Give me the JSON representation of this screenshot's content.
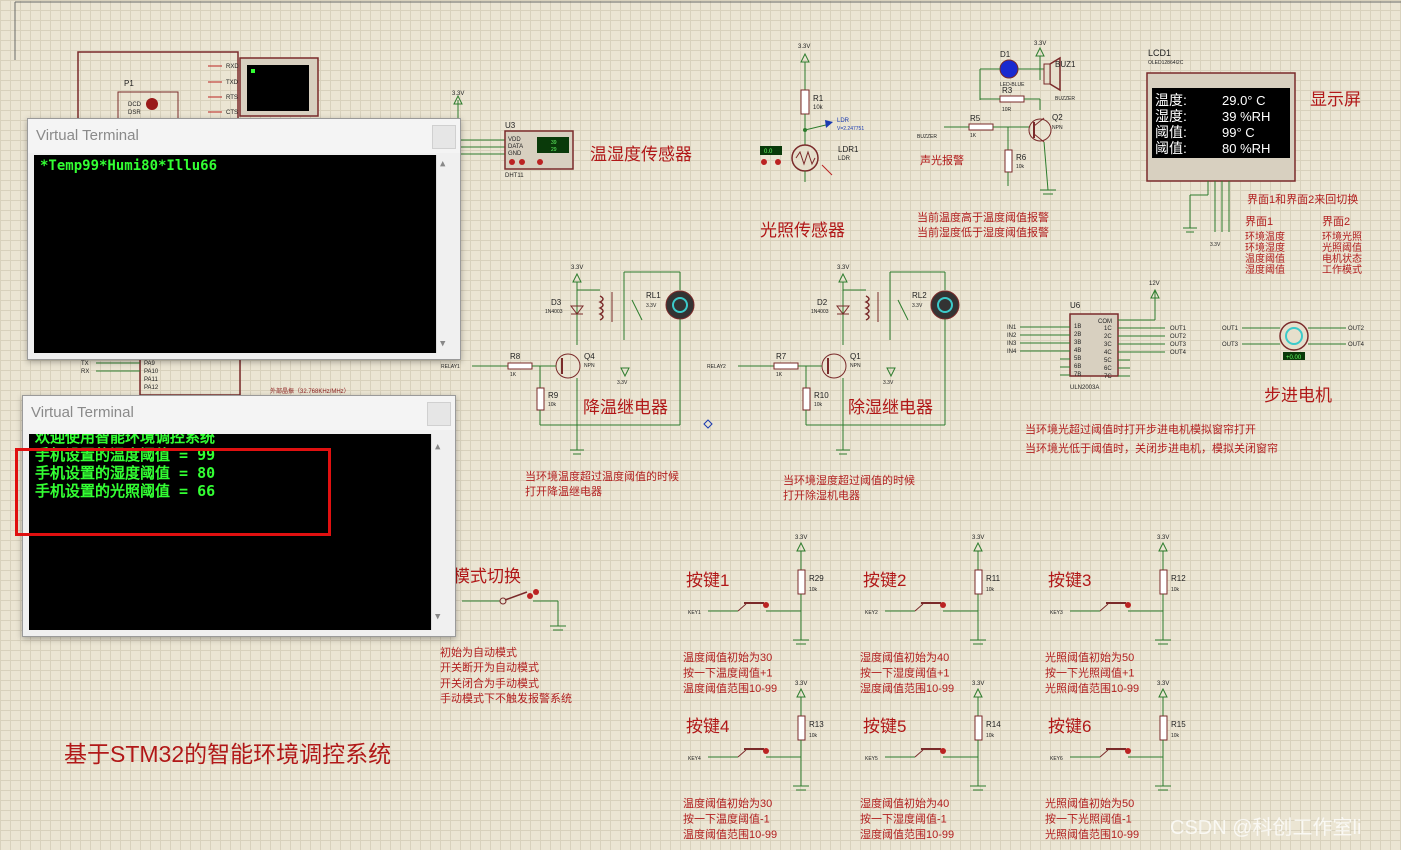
{
  "schematic": {
    "title": "基于STM32的智能环境调控系统",
    "watermark": "CSDN @科创工作室li",
    "labels": {
      "dht_section": "温湿度传感器",
      "ldr_section": "光照传感器",
      "cool_relay": "降温继电器",
      "dehum_relay": "除湿继电器",
      "lcd_section": "显示屏",
      "stepper_section": "步进电机",
      "mode_switch": "模式切换",
      "alarm": "声光报警"
    },
    "notes": {
      "alarm": [
        "当前温度高于温度阈值报警",
        "当前湿度低于湿度阈值报警"
      ],
      "cool": [
        "当环境温度超过温度阈值的时候",
        "打开降温继电器"
      ],
      "dehum": [
        "当环境湿度超过阈值的时候",
        "打开除湿机电器"
      ],
      "stepper": [
        "当环境光超过阈值时打开步进电机模拟窗帘打开",
        "当环境光低于阈值时，关闭步进电机，模拟关闭窗帘"
      ],
      "lcd_switch": "界面1和界面2来回切换",
      "page1_title": "界面1",
      "page1": [
        "环境温度",
        "环境湿度",
        "温度阈值",
        "湿度阈值"
      ],
      "page2_title": "界面2",
      "page2": [
        "环境光照",
        "光照阈值",
        "电机状态",
        "工作模式"
      ],
      "mode": [
        "初始为自动模式",
        "开关断开为自动模式",
        "开关闭合为手动模式",
        "手动模式下不触发报警系统"
      ]
    },
    "lcd": {
      "ref": "LCD1",
      "part": "OLED12864I2C",
      "rows": [
        {
          "label": "温度:",
          "value": "29.0° C"
        },
        {
          "label": "湿度:",
          "value": "39 %RH"
        },
        {
          "label": "阈值:",
          "value": "99° C"
        },
        {
          "label": "阈值:",
          "value": "80 %RH"
        }
      ],
      "pins": [
        "GND",
        "VCC",
        "SCL",
        "SDA"
      ]
    },
    "dht": {
      "ref": "U3",
      "part": "DHT11",
      "pins": [
        "VDD",
        "DATA",
        "GND"
      ],
      "val1": "39",
      "val2": "29",
      "pwr": "3.3V"
    },
    "ldr": {
      "r1": "R1",
      "r1v": "10k",
      "ref": "LDR1",
      "part": "LDR",
      "probe": "LDR",
      "voltage": "V=2.247751",
      "meter": "0.0"
    },
    "alarm_parts": {
      "led": "D1",
      "led_part": "LED-BLUE",
      "buz": "BUZ1",
      "buz_part": "BUZZER",
      "r3": "R3",
      "r3v": "10R",
      "r5": "R5",
      "r5v": "1K",
      "r6": "R6",
      "r6v": "10k",
      "q2": "Q2",
      "q2t": "NPN",
      "net": "BUZZER"
    },
    "relay1": {
      "diode": "D3",
      "dpart": "1N4003",
      "relay": "RL1",
      "rv": "3.3V",
      "q": "Q4",
      "qt": "NPN",
      "rb": "R8",
      "rbv": "1K",
      "re": "R9",
      "rev": "10k",
      "net": "RELAY1"
    },
    "relay2": {
      "diode": "D2",
      "dpart": "1N4003",
      "relay": "RL2",
      "rv": "3.3V",
      "q": "Q1",
      "qt": "NPN",
      "rb": "R7",
      "rbv": "1K",
      "re": "R10",
      "rev": "10k",
      "net": "RELAY2"
    },
    "uln": {
      "ref": "U6",
      "part": "ULN2003A",
      "in_pins": [
        "1B",
        "2B",
        "3B",
        "4B",
        "5B",
        "6B",
        "7B"
      ],
      "out_pins": [
        "COM",
        "1C",
        "2C",
        "3C",
        "4C",
        "5C",
        "6C",
        "7C"
      ],
      "inputs": [
        "IN1",
        "IN2",
        "IN3",
        "IN4"
      ],
      "outputs": [
        "OUT1",
        "OUT2",
        "OUT3",
        "OUT4"
      ],
      "vcc": "12V"
    },
    "stepper": {
      "outs_left": [
        "OUT1",
        "OUT3"
      ],
      "outs_right": [
        "OUT2",
        "OUT4"
      ],
      "readout": "+0.00"
    },
    "mcu": {
      "ref": "P1",
      "pins_top": [
        "RXD",
        "TXD",
        "RTS",
        "CTS"
      ],
      "pins_left": [
        "DCD",
        "DSR"
      ],
      "pins_pa": [
        "PA9",
        "PA10",
        "PA11",
        "PA12"
      ],
      "tx": "TX",
      "rx": "RX",
      "crystal": "外部晶振（32.768KHz/MHz）"
    },
    "buttons": [
      {
        "title": "按键1",
        "r": "R29",
        "rv": "10k",
        "key": "KEY1",
        "notes": [
          "温度阈值初始为30",
          "按一下温度阈值+1",
          "温度阈值范围10-99"
        ]
      },
      {
        "title": "按键2",
        "r": "R11",
        "rv": "10k",
        "key": "KEY2",
        "notes": [
          "湿度阈值初始为40",
          "按一下湿度阈值+1",
          "湿度阈值范围10-99"
        ]
      },
      {
        "title": "按键3",
        "r": "R12",
        "rv": "10k",
        "key": "KEY3",
        "notes": [
          "光照阈值初始为50",
          "按一下光照阈值+1",
          "光照阈值范围10-99"
        ]
      },
      {
        "title": "按键4",
        "r": "R13",
        "rv": "10k",
        "key": "KEY4",
        "notes": [
          "温度阈值初始为30",
          "按一下温度阈值-1",
          "温度阈值范围10-99"
        ]
      },
      {
        "title": "按键5",
        "r": "R14",
        "rv": "10k",
        "key": "KEY5",
        "notes": [
          "湿度阈值初始为40",
          "按一下湿度阈值-1",
          "湿度阈值范围10-99"
        ]
      },
      {
        "title": "按键6",
        "r": "R15",
        "rv": "10k",
        "key": "KEY6",
        "notes": [
          "光照阈值初始为50",
          "按一下光照阈值-1",
          "光照阈值范围10-99"
        ]
      }
    ],
    "vcc_label": "3.3V"
  },
  "terminal1": {
    "title": "Virtual Terminal",
    "lines": [
      "*Temp99*Humi80*Illu66"
    ]
  },
  "terminal2": {
    "title": "Virtual Terminal",
    "lines": [
      "欢迎使用智能环境调控系统",
      "手机设置的温度阈值 = 99",
      "手机设置的湿度阈值 = 80",
      "手机设置的光照阈值 = 66"
    ]
  },
  "colors": {
    "wire": "#2c7c2c",
    "part": "#8a1c1c",
    "label": "#b11818",
    "note": "#b22020",
    "terminal_text": "#33ff33",
    "highlight": "#e01010"
  }
}
